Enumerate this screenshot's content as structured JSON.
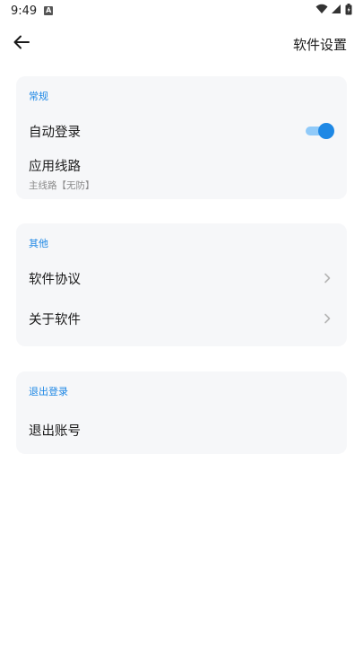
{
  "status_bar": {
    "time": "9:49",
    "notification_icon": "a-icon",
    "battery_icon": "battery-icon"
  },
  "header": {
    "title": "软件设置",
    "back_icon": "arrow-left-icon"
  },
  "sections": {
    "general": {
      "title": "常规",
      "auto_login_label": "自动登录",
      "auto_login_enabled": true,
      "route_label": "应用线路",
      "route_value": "主线路【无防】"
    },
    "other": {
      "title": "其他",
      "agreement_label": "软件协议",
      "about_label": "关于软件"
    },
    "logout": {
      "title": "退出登录",
      "logout_label": "退出账号"
    }
  },
  "colors": {
    "accent": "#1e88e5",
    "card_bg": "#f6f7f9"
  }
}
